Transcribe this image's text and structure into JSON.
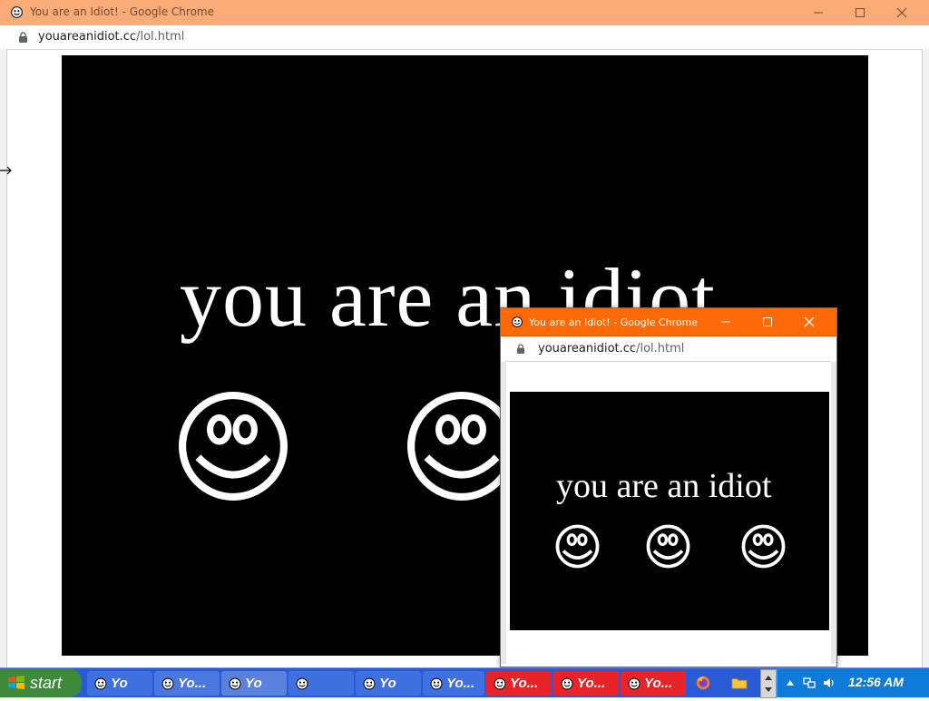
{
  "main_window": {
    "title": "You are an Idiot! - Google Chrome",
    "url_host": "youareanidiot.cc",
    "url_path": "/lol.html",
    "headline": "you are an idiot",
    "titlebar_color": "#f9ac78"
  },
  "popup_window": {
    "title": "You are an Idiot! - Google Chrome",
    "url_host": "youareanidiot.cc",
    "url_path": "/lol.html",
    "headline": "you are an idiot",
    "titlebar_color": "#ff6a08"
  },
  "taskbar": {
    "start_label": "start",
    "tasks": [
      {
        "label": "Yo",
        "icon": "smiley-icon",
        "state": "normal"
      },
      {
        "label": "Yo...",
        "icon": "smiley-icon",
        "state": "normal"
      },
      {
        "label": "Yo",
        "icon": "smiley-icon",
        "state": "normal"
      },
      {
        "label": "",
        "icon": "smiley-icon",
        "state": "normal"
      },
      {
        "label": "Yo",
        "icon": "smiley-icon",
        "state": "normal"
      },
      {
        "label": "Yo...",
        "icon": "smiley-icon",
        "state": "normal"
      },
      {
        "label": "Yo...",
        "icon": "smiley-icon",
        "state": "active"
      },
      {
        "label": "Yo...",
        "icon": "smiley-icon",
        "state": "active"
      },
      {
        "label": "Yo...",
        "icon": "smiley-icon",
        "state": "active"
      }
    ],
    "quick_icons": [
      "firefox-icon",
      "folder-icon"
    ],
    "clock": "12:56 AM",
    "tray_icons": [
      "tray-arrow-icon",
      "network-icon",
      "volume-icon"
    ]
  }
}
